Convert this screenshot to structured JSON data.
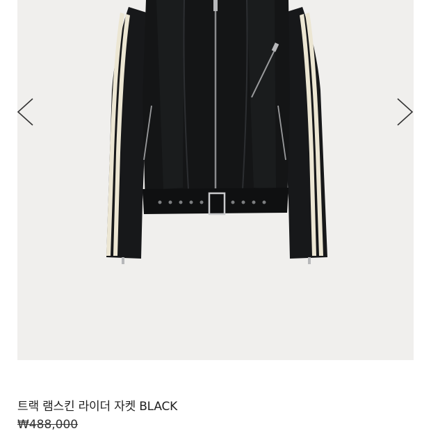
{
  "product": {
    "name": "트랙 램스킨 라이더 자켓 BLACK",
    "original_price": "₩488,000",
    "image_icon": "black-leather-rider-jacket-image"
  },
  "carousel": {
    "prev_icon": "chevron-left-icon",
    "next_icon": "chevron-right-icon"
  },
  "colors": {
    "image_background": "#f0efed",
    "jacket": "#141516",
    "stripe": "#ece6d3",
    "arrow": "#333333"
  }
}
